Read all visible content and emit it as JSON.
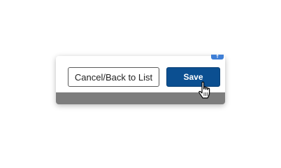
{
  "dialog": {
    "cancel_label": "Cancel/Back to List",
    "save_label": "Save",
    "corner_glyph": "↑"
  },
  "colors": {
    "save_bg": "#0b4f91",
    "footer_bar": "#7d7d7d",
    "corner_tab": "#3f7fd6"
  },
  "cursor": {
    "icon": "hand-pointer-icon"
  }
}
